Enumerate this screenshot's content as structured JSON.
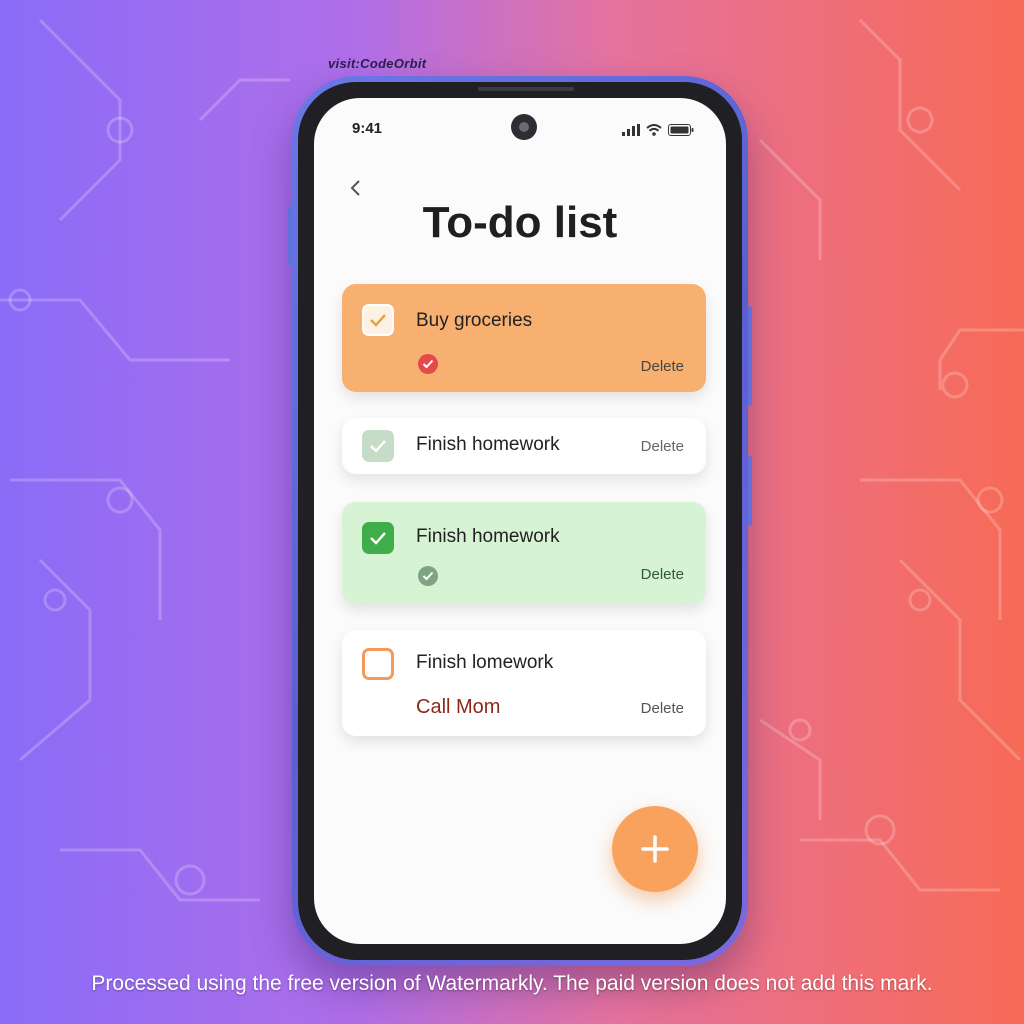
{
  "branding": {
    "top_mark": "visit:CodeOrbit"
  },
  "status_bar": {
    "time": "9:41",
    "icons": [
      "cellular-signal-icon",
      "wifi-icon",
      "battery-icon"
    ]
  },
  "header": {
    "title": "To-do list",
    "back_icon": "chevron-left-icon"
  },
  "tasks": [
    {
      "label": "Buy groceries",
      "checked": true,
      "delete_label": "Delete",
      "card_color": "#f8b070"
    },
    {
      "label": "Finish homework",
      "checked": true,
      "delete_label": "Delete",
      "card_color": "#ffffff"
    },
    {
      "label": "Finish homework",
      "checked": true,
      "delete_label": "Delete",
      "card_color": "#d6f3d4"
    },
    {
      "label": "Finish lomework",
      "sub_label": "Call Mom",
      "checked": false,
      "delete_label": "Delete",
      "card_color": "#ffffff"
    }
  ],
  "fab": {
    "icon": "plus-icon",
    "color": "#f8a25e"
  },
  "footer_note": "Processed using the free version of Watermarkly. The paid version does not add this mark.",
  "colors": {
    "accent_orange": "#f8a25e",
    "accent_green": "#3fae4a",
    "alert_red": "#e44a4a"
  }
}
